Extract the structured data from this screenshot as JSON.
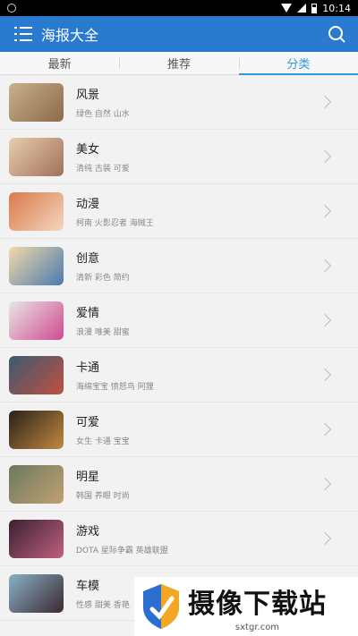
{
  "status_bar": {
    "time": "10:14"
  },
  "app_bar": {
    "title": "海报大全"
  },
  "tabs": [
    {
      "label": "最新",
      "active": false
    },
    {
      "label": "推荐",
      "active": false
    },
    {
      "label": "分类",
      "active": true
    }
  ],
  "categories": [
    {
      "name": "风景",
      "tags": "绿色 自然 山水",
      "thumb_colors": [
        "#c9b08d",
        "#8a6a4a"
      ]
    },
    {
      "name": "美女",
      "tags": "清纯 古装 可爱",
      "thumb_colors": [
        "#e8cdb0",
        "#a0705a"
      ]
    },
    {
      "name": "动漫",
      "tags": "柯南 火影忍者 海贼王",
      "thumb_colors": [
        "#d97a4a",
        "#f4d6c0"
      ]
    },
    {
      "name": "创意",
      "tags": "清新 彩色 简约",
      "thumb_colors": [
        "#f2d9a8",
        "#4a7ab0"
      ]
    },
    {
      "name": "爱情",
      "tags": "浪漫 唯美 甜蜜",
      "thumb_colors": [
        "#e9e6e4",
        "#d04a90"
      ]
    },
    {
      "name": "卡通",
      "tags": "海绵宝宝 愤怒鸟 阿狸",
      "thumb_colors": [
        "#3a5a70",
        "#c05040"
      ]
    },
    {
      "name": "可爱",
      "tags": "女生 卡通 宝宝",
      "thumb_colors": [
        "#2a2018",
        "#c08a40"
      ]
    },
    {
      "name": "明星",
      "tags": "韩国 养眼 时尚",
      "thumb_colors": [
        "#6a7a60",
        "#c0a070"
      ]
    },
    {
      "name": "游戏",
      "tags": "DOTA 星际争霸 英雄联盟",
      "thumb_colors": [
        "#3a2030",
        "#c06080"
      ]
    },
    {
      "name": "车模",
      "tags": "性感 甜美 香艳",
      "thumb_colors": [
        "#8ab0c8",
        "#3a2a30"
      ]
    }
  ],
  "watermark": {
    "title": "摄像下载站",
    "url": "sxtgr.com"
  },
  "colors": {
    "primary": "#2a7bd0",
    "tab_active": "#2a9ad8"
  }
}
